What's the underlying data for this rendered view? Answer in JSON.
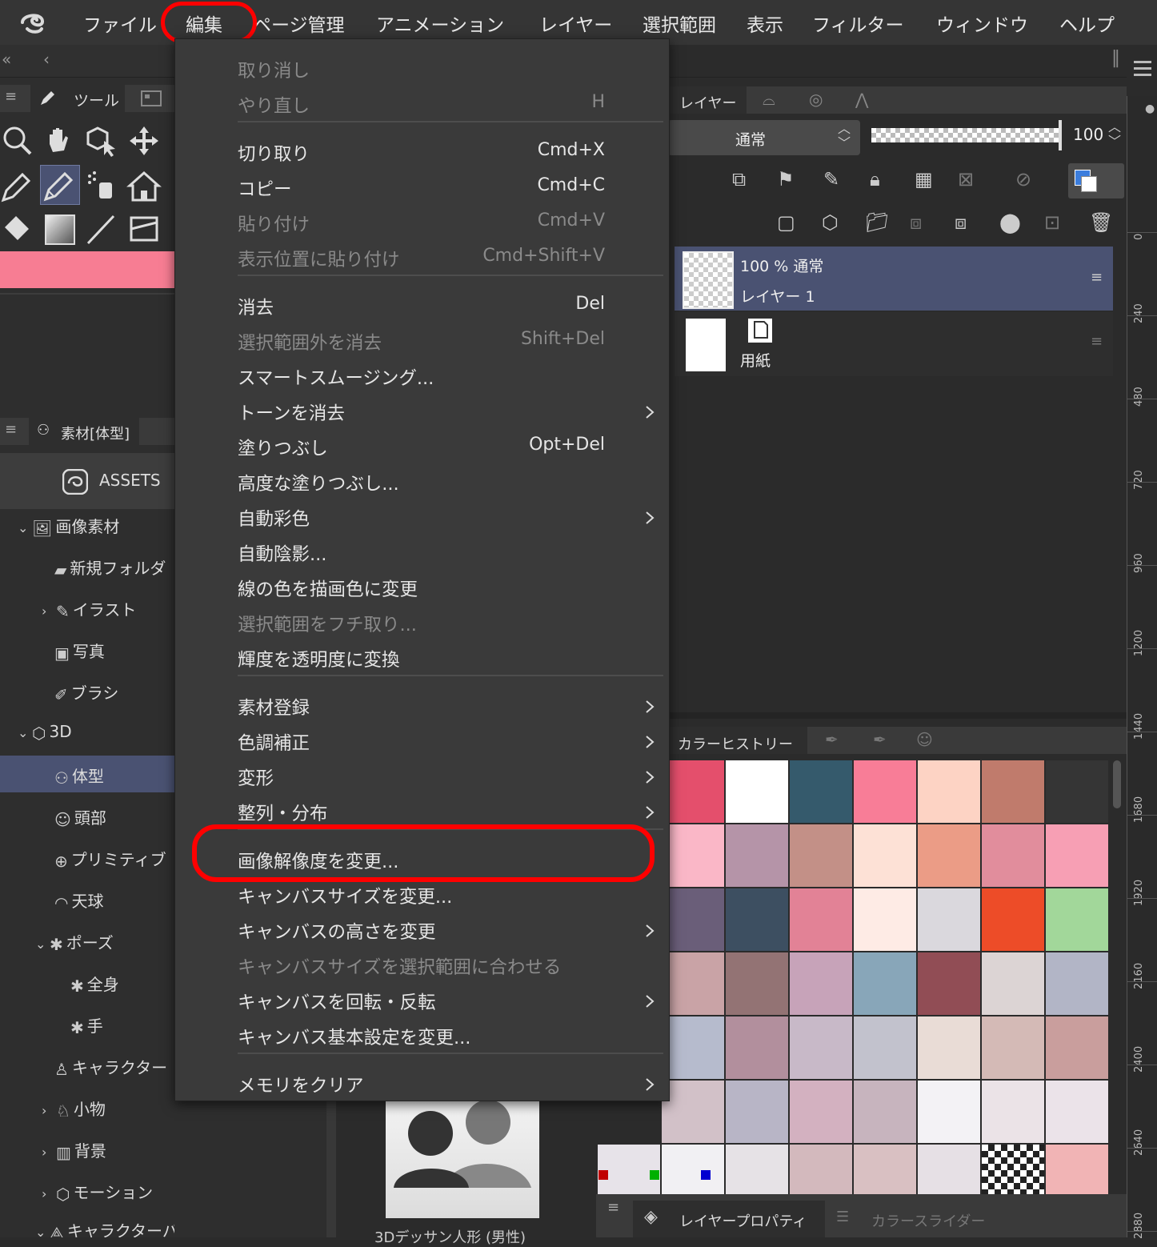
{
  "menubar": {
    "items": [
      "ファイル",
      "編集",
      "ページ管理",
      "アニメーション",
      "レイヤー",
      "選択範囲",
      "表示",
      "フィルター",
      "ウィンドウ",
      "ヘルプ"
    ]
  },
  "left_panel": {
    "tool_tab": "ツール",
    "assets_tab": "素材[体型]",
    "assets_label": "ASSETS",
    "tree": [
      {
        "label": "画像素材"
      },
      {
        "label": "新規フォルダ"
      },
      {
        "label": "イラスト"
      },
      {
        "label": "写真"
      },
      {
        "label": "ブラシ"
      },
      {
        "label": "3D"
      },
      {
        "label": "体型"
      },
      {
        "label": "頭部"
      },
      {
        "label": "プリミティブ"
      },
      {
        "label": "天球"
      },
      {
        "label": "ポーズ"
      },
      {
        "label": "全身"
      },
      {
        "label": "手"
      },
      {
        "label": "キャラクター"
      },
      {
        "label": "小物"
      },
      {
        "label": "背景"
      },
      {
        "label": "モーション"
      },
      {
        "label": "キャラクターパーツ"
      }
    ],
    "preview_caption": "3Dデッサン人形 (男性)",
    "brush_color": "#f77d93"
  },
  "layer_panel": {
    "tab": "レイヤー",
    "blend_mode": "通常",
    "opacity": "100",
    "layers": [
      {
        "info": "100 % 通常",
        "name": "レイヤー 1"
      },
      {
        "name": "用紙"
      }
    ]
  },
  "color_history": {
    "tab": "カラーヒストリー",
    "swatches": [
      [
        "#e44f6c",
        "#ffffff",
        "#355a6c",
        "#f87d97",
        "#fdd3c4",
        "#c07b6c",
        "#353535"
      ],
      [
        "#fab7c7",
        "#b594a8",
        "#c39087",
        "#fde1d6",
        "#eb9c86",
        "#e18d9c",
        "#f79fb4"
      ],
      [
        "#6a5e79",
        "#3d4f61",
        "#e28296",
        "#feebe5",
        "#dad8dd",
        "#ed4c28",
        "#a2d79a"
      ],
      [
        "#c9a3a6",
        "#937374",
        "#c7a3b9",
        "#88a6b9",
        "#914d55",
        "#dcd4d4",
        "#b2b5c6"
      ],
      [
        "#b6bbcd",
        "#b28f9d",
        "#c8b9c8",
        "#c2c2cd",
        "#e9dcd6",
        "#d4bab6",
        "#c99e9d"
      ],
      [
        "#d2c1c8",
        "#b8b5c6",
        "#d3b1c0",
        "#c7b4be",
        "#f3f2f5",
        "#ebe3e7",
        "#ebe3e9"
      ],
      [
        "#e7e3e9",
        "#f1f0f3",
        "#e6e2e6",
        "#d3b9bd",
        "#d9c0c2",
        "#e6e0e5",
        "checker",
        "#f1b4b5"
      ]
    ]
  },
  "bottom_tabs": [
    "レイヤープロパティ",
    "カラースライダー"
  ],
  "ruler": [
    "0",
    "240",
    "480",
    "720",
    "960",
    "1200",
    "1440",
    "1680",
    "1920",
    "2160",
    "2400",
    "2640",
    "2880"
  ],
  "menu": {
    "items": [
      {
        "label": "取り消し",
        "shortcut": "",
        "disabled": true
      },
      {
        "label": "やり直し",
        "shortcut": "H",
        "disabled": true
      },
      {
        "label": "切り取り",
        "shortcut": "Cmd+X"
      },
      {
        "label": "コピー",
        "shortcut": "Cmd+C"
      },
      {
        "label": "貼り付け",
        "shortcut": "Cmd+V",
        "disabled": true
      },
      {
        "label": "表示位置に貼り付け",
        "shortcut": "Cmd+Shift+V",
        "disabled": true
      },
      {
        "label": "消去",
        "shortcut": "Del"
      },
      {
        "label": "選択範囲外を消去",
        "shortcut": "Shift+Del",
        "disabled": true
      },
      {
        "label": "スマートスムージング...",
        "shortcut": ""
      },
      {
        "label": "トーンを消去",
        "shortcut": "",
        "submenu": true
      },
      {
        "label": "塗りつぶし",
        "shortcut": "Opt+Del"
      },
      {
        "label": "高度な塗りつぶし...",
        "shortcut": ""
      },
      {
        "label": "自動彩色",
        "shortcut": "",
        "submenu": true
      },
      {
        "label": "自動陰影...",
        "shortcut": ""
      },
      {
        "label": "線の色を描画色に変更",
        "shortcut": ""
      },
      {
        "label": "選択範囲をフチ取り...",
        "shortcut": "",
        "disabled": true
      },
      {
        "label": "輝度を透明度に変換",
        "shortcut": ""
      },
      {
        "label": "素材登録",
        "shortcut": "",
        "submenu": true
      },
      {
        "label": "色調補正",
        "shortcut": "",
        "submenu": true
      },
      {
        "label": "変形",
        "shortcut": "",
        "submenu": true
      },
      {
        "label": "整列・分布",
        "shortcut": "",
        "submenu": true
      },
      {
        "label": "画像解像度を変更...",
        "shortcut": "",
        "highlighted": true
      },
      {
        "label": "キャンバスサイズを変更...",
        "shortcut": ""
      },
      {
        "label": "キャンバスの高さを変更",
        "shortcut": "",
        "submenu": true
      },
      {
        "label": "キャンバスサイズを選択範囲に合わせる",
        "shortcut": "",
        "disabled": true
      },
      {
        "label": "キャンバスを回転・反転",
        "shortcut": "",
        "submenu": true
      },
      {
        "label": "キャンバス基本設定を変更...",
        "shortcut": ""
      },
      {
        "label": "メモリをクリア",
        "shortcut": "",
        "submenu": true
      }
    ]
  },
  "annotation_color": "#ff0000"
}
